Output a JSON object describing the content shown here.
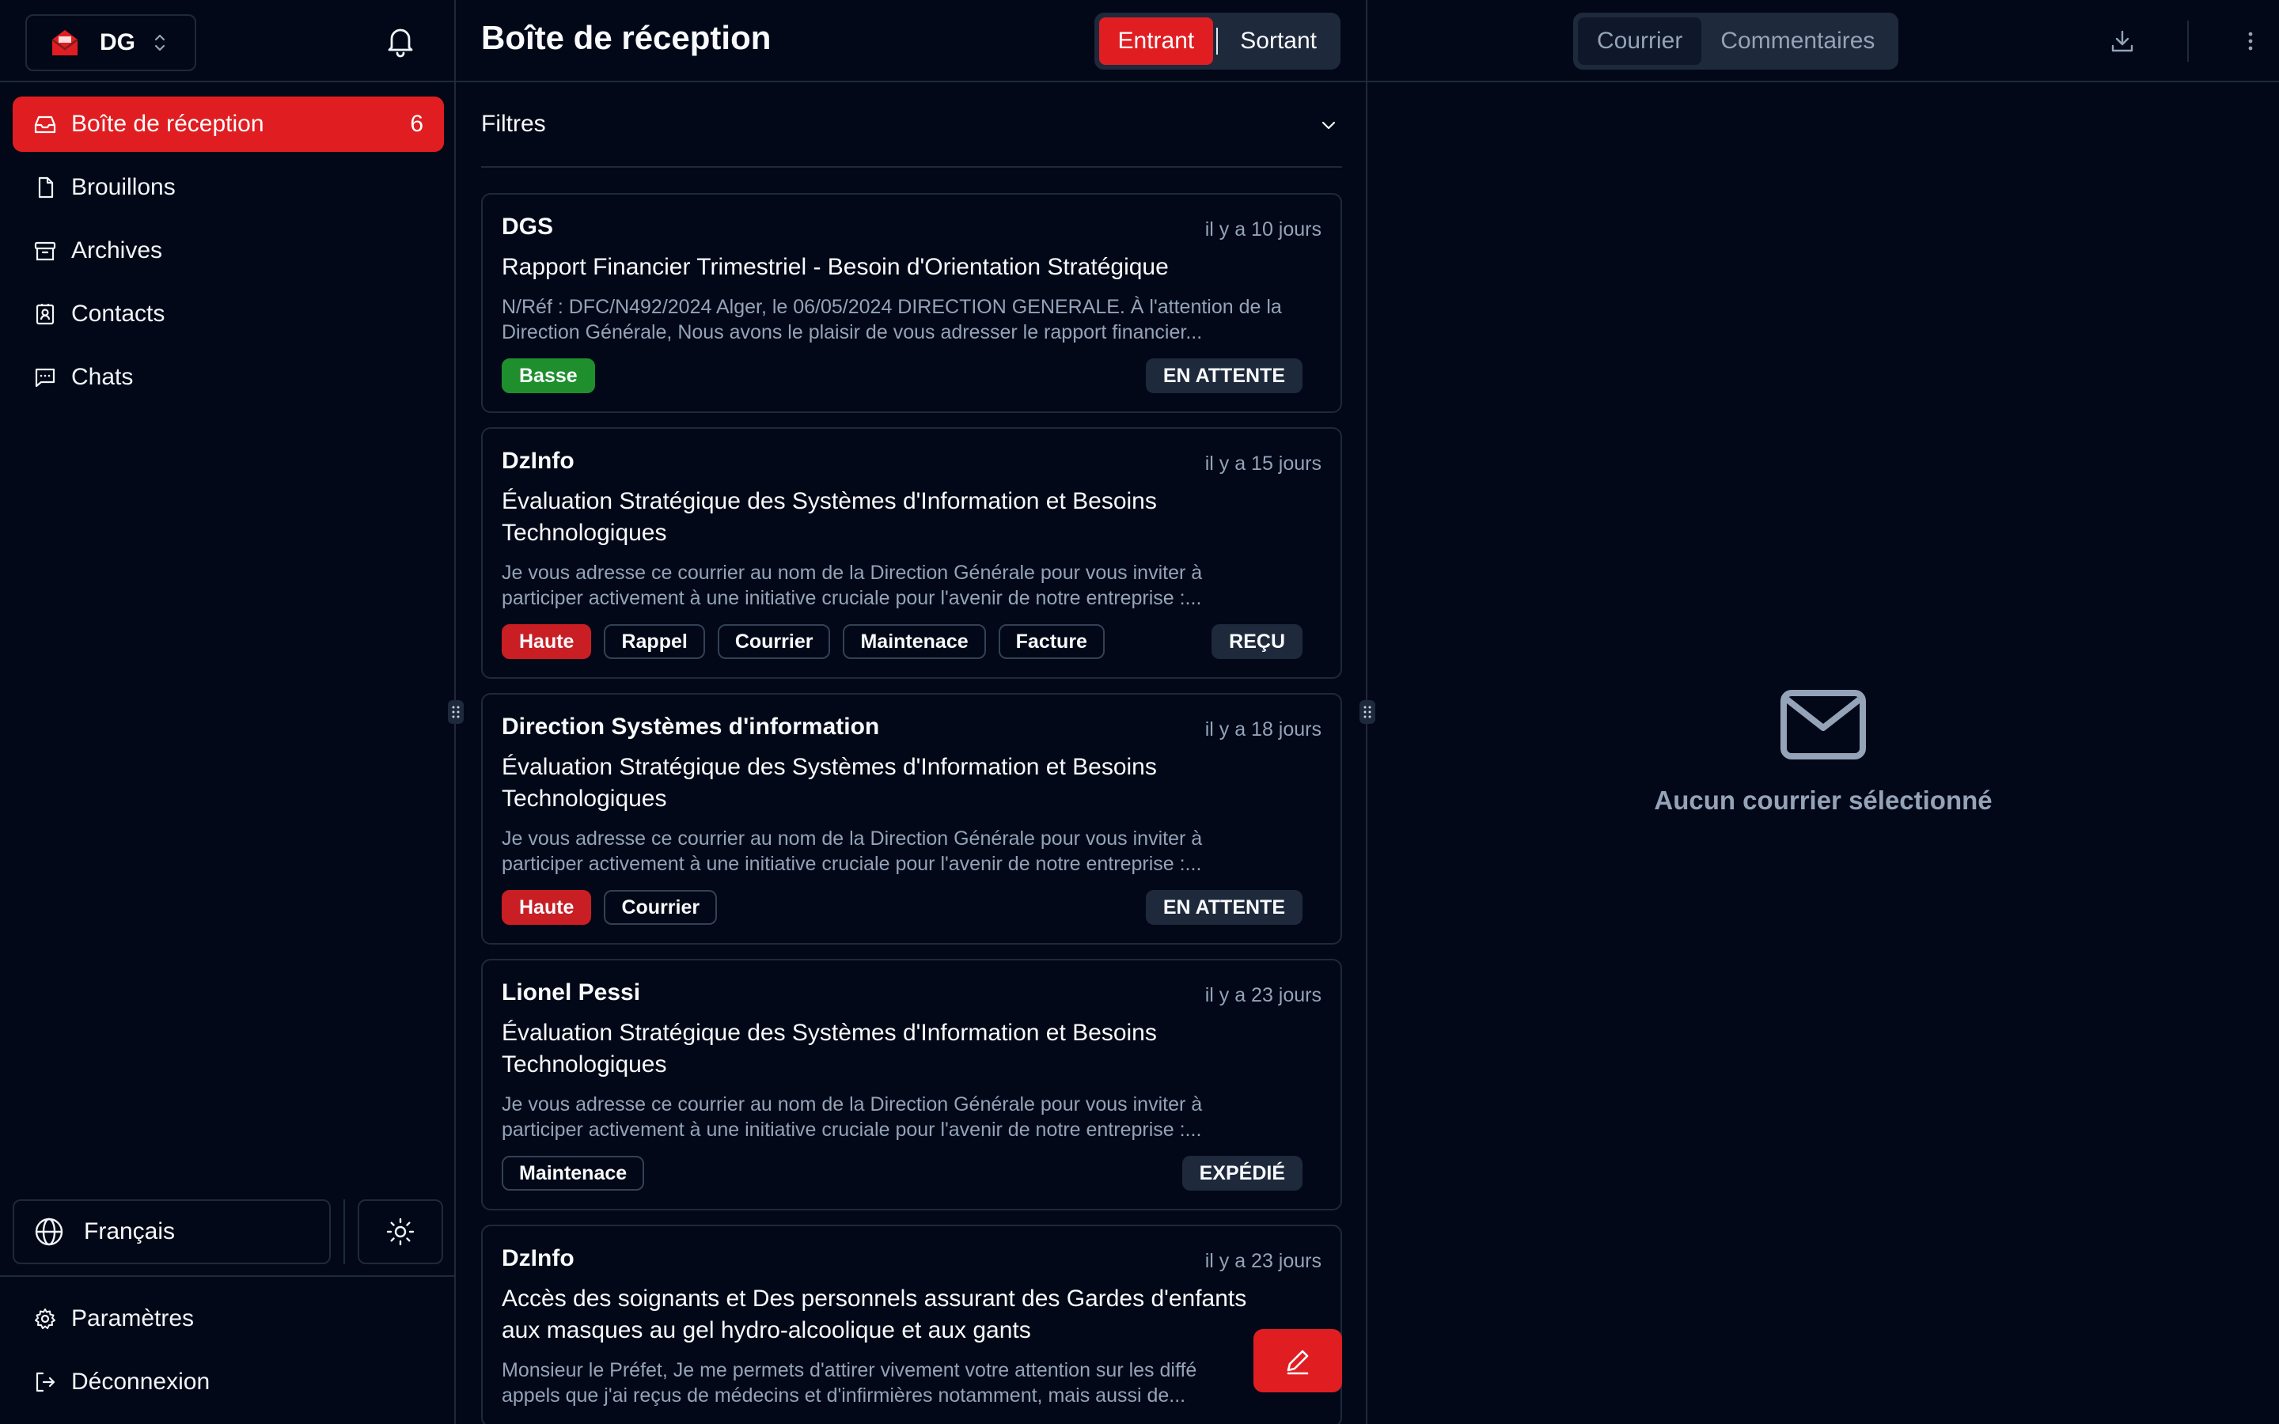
{
  "org": {
    "name": "DG"
  },
  "sidebar": {
    "items": [
      {
        "label": "Boîte de réception",
        "count": "6",
        "icon": "inbox-icon",
        "active": true
      },
      {
        "label": "Brouillons",
        "icon": "file-icon"
      },
      {
        "label": "Archives",
        "icon": "archive-icon"
      },
      {
        "label": "Contacts",
        "icon": "contact-icon"
      },
      {
        "label": "Chats",
        "icon": "chat-icon"
      }
    ],
    "language": "Français",
    "settings": "Paramètres",
    "logout": "Déconnexion"
  },
  "inbox": {
    "title": "Boîte de réception",
    "toggle": {
      "incoming": "Entrant",
      "outgoing": "Sortant"
    },
    "filters": "Filtres",
    "mails": [
      {
        "from": "DGS",
        "when": "il y a 10 jours",
        "subject": "Rapport Financier Trimestriel - Besoin d'Orientation Stratégique",
        "preview1": "N/Réf : DFC/N492/2024 Alger, le 06/05/2024 DIRECTION GENERALE. À l'attention de la",
        "preview2": "Direction Générale, Nous avons le plaisir de vous adresser le rapport financier...",
        "priority": "Basse",
        "tags": [],
        "status": "EN ATTENTE"
      },
      {
        "from": "DzInfo",
        "when": "il y a 15 jours",
        "subject1": "Évaluation Stratégique des Systèmes d'Information et Besoins",
        "subject2": "Technologiques",
        "preview1": "Je vous adresse ce courrier au nom de la Direction Générale pour vous inviter à",
        "preview2": "participer activement à une initiative cruciale pour l'avenir de notre entreprise :...",
        "priority": "Haute",
        "tags": [
          "Rappel",
          "Courrier",
          "Maintenace",
          "Facture"
        ],
        "status": "REÇU"
      },
      {
        "from": "Direction Systèmes d'information",
        "when": "il y a 18 jours",
        "subject1": "Évaluation Stratégique des Systèmes d'Information et Besoins",
        "subject2": "Technologiques",
        "preview1": "Je vous adresse ce courrier au nom de la Direction Générale pour vous inviter à",
        "preview2": "participer activement à une initiative cruciale pour l'avenir de notre entreprise :...",
        "priority": "Haute",
        "tags": [
          "Courrier"
        ],
        "status": "EN ATTENTE"
      },
      {
        "from": "Lionel Pessi",
        "when": "il y a 23 jours",
        "subject1": "Évaluation Stratégique des Systèmes d'Information et Besoins",
        "subject2": "Technologiques",
        "preview1": "Je vous adresse ce courrier au nom de la Direction Générale pour vous inviter à",
        "preview2": "participer activement à une initiative cruciale pour l'avenir de notre entreprise :...",
        "tags": [
          "Maintenace"
        ],
        "status": "EXPÉDIÉ"
      },
      {
        "from": "DzInfo",
        "when": "il y a 23 jours",
        "subject1": "Accès des soignants et Des personnels assurant des Gardes d'enfants",
        "subject2": "aux masques au gel hydro-alcoolique et aux gants",
        "preview1": "Monsieur le Préfet, Je me permets d'attirer vivement votre attention sur les diffé",
        "preview2": "appels que j'ai reçus de médecins et d'infirmières notamment, mais aussi de..."
      }
    ]
  },
  "detail": {
    "tabs": {
      "mail": "Courrier",
      "comments": "Commentaires"
    },
    "empty": "Aucun courrier sélectionné"
  },
  "colors": {
    "accent": "#e01e22",
    "low": "#1f8f2e",
    "high": "#c81e24",
    "bg": "#020817"
  }
}
